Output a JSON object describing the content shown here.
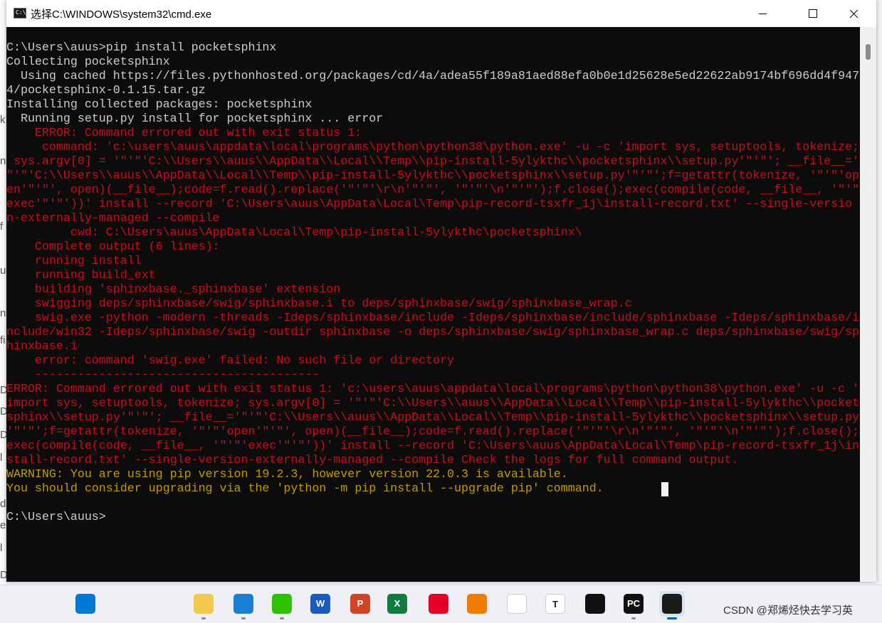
{
  "background_app": {
    "fragments": [
      "k",
      "ns",
      "f",
      "u",
      "ns",
      "fi",
      "D",
      "D",
      "D",
      "l",
      "d",
      "e",
      "l",
      "De"
    ]
  },
  "window": {
    "title": "选择C:\\WINDOWS\\system32\\cmd.exe",
    "icon_label": "C:\\_",
    "controls": {
      "minimize": "minimize",
      "maximize": "maximize",
      "close": "close"
    }
  },
  "console": {
    "lines": [
      {
        "text": "C:\\Users\\auus>pip install pocketsphinx",
        "color": "w"
      },
      {
        "text": "Collecting pocketsphinx",
        "color": "w"
      },
      {
        "text": "  Using cached https://files.pythonhosted.org/packages/cd/4a/adea55f189a81aed88efa0b0e1d25628e5ed22622ab9174bf696dd4f947",
        "color": "w"
      },
      {
        "text": "4/pocketsphinx-0.1.15.tar.gz",
        "color": "w"
      },
      {
        "text": "Installing collected packages: pocketsphinx",
        "color": "w"
      },
      {
        "text": "  Running setup.py install for pocketsphinx ... error",
        "color": "w"
      },
      {
        "text": "    ERROR: Command errored out with exit status 1:",
        "color": "r"
      },
      {
        "text": "     command: 'c:\\users\\auus\\appdata\\local\\programs\\python\\python38\\python.exe' -u -c 'import sys, setuptools, tokenize;",
        "color": "r"
      },
      {
        "text": " sys.argv[0] = '\"'\"'C:\\\\Users\\\\auus\\\\AppData\\\\Local\\\\Temp\\\\pip-install-5ylykthc\\\\pocketsphinx\\\\setup.py'\"'\"'; __file__='",
        "color": "r"
      },
      {
        "text": "\"'\"'C:\\\\Users\\\\auus\\\\AppData\\\\Local\\\\Temp\\\\pip-install-5ylykthc\\\\pocketsphinx\\\\setup.py'\"'\"';f=getattr(tokenize, '\"'\"'op",
        "color": "r"
      },
      {
        "text": "en'\"'\"', open)(__file__);code=f.read().replace('\"'\"'\\r\\n'\"'\"', '\"'\"'\\n'\"'\"');f.close();exec(compile(code, __file__, '\"'\"'",
        "color": "r"
      },
      {
        "text": "exec'\"'\"'))' install --record 'C:\\Users\\auus\\AppData\\Local\\Temp\\pip-record-tsxfr_1j\\install-record.txt' --single-versio",
        "color": "r"
      },
      {
        "text": "n-externally-managed --compile",
        "color": "r"
      },
      {
        "text": "         cwd: C:\\Users\\auus\\AppData\\Local\\Temp\\pip-install-5ylykthc\\pocketsphinx\\",
        "color": "r"
      },
      {
        "text": "    Complete output (6 lines):",
        "color": "r"
      },
      {
        "text": "    running install",
        "color": "r"
      },
      {
        "text": "    running build_ext",
        "color": "r"
      },
      {
        "text": "    building 'sphinxbase._sphinxbase' extension",
        "color": "r"
      },
      {
        "text": "    swigging deps/sphinxbase/swig/sphinxbase.i to deps/sphinxbase/swig/sphinxbase_wrap.c",
        "color": "r"
      },
      {
        "text": "    swig.exe -python -modern -threads -Ideps/sphinxbase/include -Ideps/sphinxbase/include/sphinxbase -Ideps/sphinxbase/i",
        "color": "r"
      },
      {
        "text": "nclude/win32 -Ideps/sphinxbase/swig -outdir sphinxbase -o deps/sphinxbase/swig/sphinxbase_wrap.c deps/sphinxbase/swig/sp",
        "color": "r"
      },
      {
        "text": "hinxbase.i",
        "color": "r"
      },
      {
        "text": "    error: command 'swig.exe' failed: No such file or directory",
        "color": "r"
      },
      {
        "text": "    ----------------------------------------",
        "color": "r"
      },
      {
        "text": "ERROR: Command errored out with exit status 1: 'c:\\users\\auus\\appdata\\local\\programs\\python\\python38\\python.exe' -u -c '",
        "color": "r"
      },
      {
        "text": "import sys, setuptools, tokenize; sys.argv[0] = '\"'\"'C:\\\\Users\\\\auus\\\\AppData\\\\Local\\\\Temp\\\\pip-install-5ylykthc\\\\pocket",
        "color": "r"
      },
      {
        "text": "sphinx\\\\setup.py'\"'\"'; __file__='\"'\"'C:\\\\Users\\\\auus\\\\AppData\\\\Local\\\\Temp\\\\pip-install-5ylykthc\\\\pocketsphinx\\\\setup.py",
        "color": "r"
      },
      {
        "text": "'\"'\"';f=getattr(tokenize, '\"'\"'open'\"'\"', open)(__file__);code=f.read().replace('\"'\"'\\r\\n'\"'\"', '\"'\"'\\n'\"'\"');f.close();",
        "color": "r"
      },
      {
        "text": "exec(compile(code, __file__, '\"'\"'exec'\"'\"'))' install --record 'C:\\Users\\auus\\AppData\\Local\\Temp\\pip-record-tsxfr_1j\\in",
        "color": "r"
      },
      {
        "text": "stall-record.txt' --single-version-externally-managed --compile Check the logs for full command output.",
        "color": "r"
      },
      {
        "text": "WARNING: You are using pip version 19.2.3, however version 22.0.3 is available.",
        "color": "y"
      },
      {
        "text": "You should consider upgrading via the 'python -m pip install --upgrade pip' command.",
        "color": "y"
      },
      {
        "text": "",
        "color": "w"
      },
      {
        "text": "C:\\Users\\auus>",
        "color": "w"
      }
    ]
  },
  "taskbar": {
    "items": [
      {
        "name": "start-button",
        "icon": "windows-logo-icon",
        "label": "",
        "bg": "#0078d4",
        "running": false
      },
      {
        "name": "search-button",
        "icon": "search-icon",
        "label": "",
        "bg": "transparent",
        "running": false
      },
      {
        "name": "task-view-button",
        "icon": "task-view-icon",
        "label": "",
        "bg": "transparent",
        "running": false
      },
      {
        "name": "file-explorer-button",
        "icon": "folder-icon",
        "label": "",
        "bg": "#f2c94c",
        "running": true
      },
      {
        "name": "vscode-button",
        "icon": "vscode-icon",
        "label": "",
        "bg": "#1a7fd4",
        "running": true
      },
      {
        "name": "wechat-button",
        "icon": "wechat-icon",
        "label": "",
        "bg": "#2dc100",
        "running": true
      },
      {
        "name": "word-button",
        "icon": "word-icon",
        "label": "W",
        "bg": "#185abd",
        "running": false
      },
      {
        "name": "powerpoint-button",
        "icon": "powerpoint-icon",
        "label": "P",
        "bg": "#d04423",
        "running": false
      },
      {
        "name": "excel-button",
        "icon": "excel-icon",
        "label": "X",
        "bg": "#107c41",
        "running": false
      },
      {
        "name": "netease-music-button",
        "icon": "netease-music-icon",
        "label": "",
        "bg": "#e60026",
        "running": false
      },
      {
        "name": "aurix-button",
        "icon": "aurix-icon",
        "label": "",
        "bg": "#f07d00",
        "running": false
      },
      {
        "name": "chrome-button",
        "icon": "chrome-icon",
        "label": "",
        "bg": "#ffffff",
        "running": false
      },
      {
        "name": "typora-button",
        "icon": "typora-icon",
        "label": "T",
        "bg": "#ffffff",
        "running": false
      },
      {
        "name": "app-black-button",
        "icon": "diamond-app-icon",
        "label": "",
        "bg": "#111111",
        "running": false
      },
      {
        "name": "pycharm-button",
        "icon": "pycharm-icon",
        "label": "PC",
        "bg": "#111111",
        "running": true
      },
      {
        "name": "cmd-button",
        "icon": "terminal-icon",
        "label": "",
        "bg": "#1b1b1b",
        "running": true
      }
    ],
    "watermark": "CSDN @郑烯烃快去学习",
    "ime_indicator": "英"
  }
}
